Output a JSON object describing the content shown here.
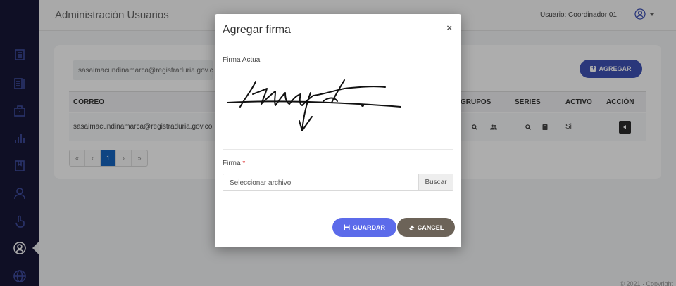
{
  "header": {
    "title": "Administración Usuarios",
    "user_label": "Usuario: Coordinador 01"
  },
  "sidebar": {
    "items": [
      {
        "icon": "document-icon"
      },
      {
        "icon": "list-document-icon"
      },
      {
        "icon": "briefcase-icon"
      },
      {
        "icon": "bar-chart-icon"
      },
      {
        "icon": "book-icon"
      },
      {
        "icon": "person-icon"
      },
      {
        "icon": "hand-pointer-icon"
      },
      {
        "icon": "user-circle-icon",
        "active": true
      },
      {
        "icon": "globe-icon"
      }
    ]
  },
  "filter": {
    "email_value": "sasaimacundinamarca@registraduria.gov.co"
  },
  "add_button": {
    "label": "AGREGAR"
  },
  "table": {
    "columns": [
      "CORREO",
      "GRUPOS",
      "SERIES",
      "ACTIVO",
      "ACCIÓN"
    ],
    "rows": [
      {
        "correo": "sasaimacundinamarca@registraduria.gov.co",
        "activo": "Si"
      }
    ]
  },
  "pagination": {
    "items": [
      "«",
      "‹",
      "1",
      "›",
      "»"
    ],
    "current": "1"
  },
  "footer": {
    "text": "© 2021 · Copyright"
  },
  "modal": {
    "title": "Agregar firma",
    "close": "×",
    "current_signature_label": "Firma Actual",
    "firma_label": "Firma",
    "required_mark": "*",
    "file_placeholder": "Seleccionar archivo",
    "browse_label": "Buscar",
    "save_label": "GUARDAR",
    "cancel_label": "CANCEL"
  },
  "colors": {
    "sidebar_bg": "#171737",
    "primary": "#3f51b5",
    "save_button": "#5c6bea",
    "cancel_button": "#6c6358"
  }
}
